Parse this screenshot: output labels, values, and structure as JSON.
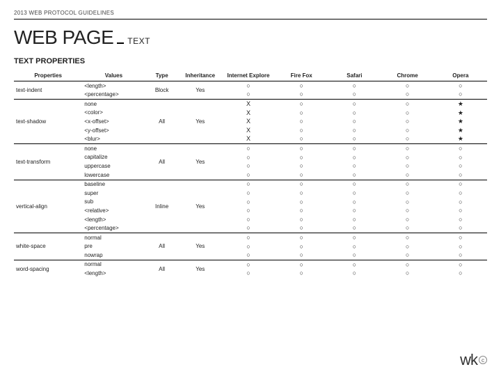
{
  "header": {
    "top_label": "2013 WEB PROTOCOL GUIDELINES",
    "title_main": "WEB PAGE",
    "title_sub": "TEXT",
    "section": "TEXT PROPERTIES"
  },
  "columns": [
    "Properties",
    "Values",
    "Type",
    "Inheritance",
    "Internet Explore",
    "Fire Fox",
    "Safari",
    "Chrome",
    "Opera"
  ],
  "symbols": {
    "yes": "○",
    "no": "X",
    "star": "★"
  },
  "groups": [
    {
      "property": "text-indent",
      "type": "Block",
      "inheritance": "Yes",
      "rows": [
        {
          "value": "<length>",
          "support": [
            "yes",
            "yes",
            "yes",
            "yes",
            "yes"
          ]
        },
        {
          "value": "<percentage>",
          "support": [
            "yes",
            "yes",
            "yes",
            "yes",
            "yes"
          ]
        }
      ]
    },
    {
      "property": "text-shadow",
      "type": "All",
      "inheritance": "Yes",
      "rows": [
        {
          "value": "none",
          "support": [
            "no",
            "yes",
            "yes",
            "yes",
            "star"
          ]
        },
        {
          "value": "<color>",
          "support": [
            "no",
            "yes",
            "yes",
            "yes",
            "star"
          ]
        },
        {
          "value": "<x-offset>",
          "support": [
            "no",
            "yes",
            "yes",
            "yes",
            "star"
          ]
        },
        {
          "value": "<y-offset>",
          "support": [
            "no",
            "yes",
            "yes",
            "yes",
            "star"
          ]
        },
        {
          "value": "<blur>",
          "support": [
            "no",
            "yes",
            "yes",
            "yes",
            "star"
          ]
        }
      ]
    },
    {
      "property": "text-transform",
      "type": "All",
      "inheritance": "Yes",
      "rows": [
        {
          "value": "none",
          "support": [
            "yes",
            "yes",
            "yes",
            "yes",
            "yes"
          ]
        },
        {
          "value": "capitalize",
          "support": [
            "yes",
            "yes",
            "yes",
            "yes",
            "yes"
          ]
        },
        {
          "value": "uppercase",
          "support": [
            "yes",
            "yes",
            "yes",
            "yes",
            "yes"
          ]
        },
        {
          "value": "lowercase",
          "support": [
            "yes",
            "yes",
            "yes",
            "yes",
            "yes"
          ]
        }
      ]
    },
    {
      "property": "vertical-align",
      "type": "Inline",
      "inheritance": "Yes",
      "rows": [
        {
          "value": "baseline",
          "support": [
            "yes",
            "yes",
            "yes",
            "yes",
            "yes"
          ]
        },
        {
          "value": "super",
          "support": [
            "yes",
            "yes",
            "yes",
            "yes",
            "yes"
          ]
        },
        {
          "value": "sub",
          "support": [
            "yes",
            "yes",
            "yes",
            "yes",
            "yes"
          ]
        },
        {
          "value": "<relative>",
          "support": [
            "yes",
            "yes",
            "yes",
            "yes",
            "yes"
          ]
        },
        {
          "value": "<length>",
          "support": [
            "yes",
            "yes",
            "yes",
            "yes",
            "yes"
          ]
        },
        {
          "value": "<percentage>",
          "support": [
            "yes",
            "yes",
            "yes",
            "yes",
            "yes"
          ]
        }
      ]
    },
    {
      "property": "white-space",
      "type": "All",
      "inheritance": "Yes",
      "rows": [
        {
          "value": "normal",
          "support": [
            "yes",
            "yes",
            "yes",
            "yes",
            "yes"
          ]
        },
        {
          "value": "pre",
          "support": [
            "yes",
            "yes",
            "yes",
            "yes",
            "yes"
          ]
        },
        {
          "value": "nowrap",
          "support": [
            "yes",
            "yes",
            "yes",
            "yes",
            "yes"
          ]
        }
      ]
    },
    {
      "property": "word-spacing",
      "type": "All",
      "inheritance": "Yes",
      "rows": [
        {
          "value": "normal",
          "support": [
            "yes",
            "yes",
            "yes",
            "yes",
            "yes"
          ]
        },
        {
          "value": "<length>",
          "support": [
            "yes",
            "yes",
            "yes",
            "yes",
            "yes"
          ]
        }
      ]
    }
  ],
  "footer": {
    "logo_text": "wk",
    "mark": "c"
  }
}
